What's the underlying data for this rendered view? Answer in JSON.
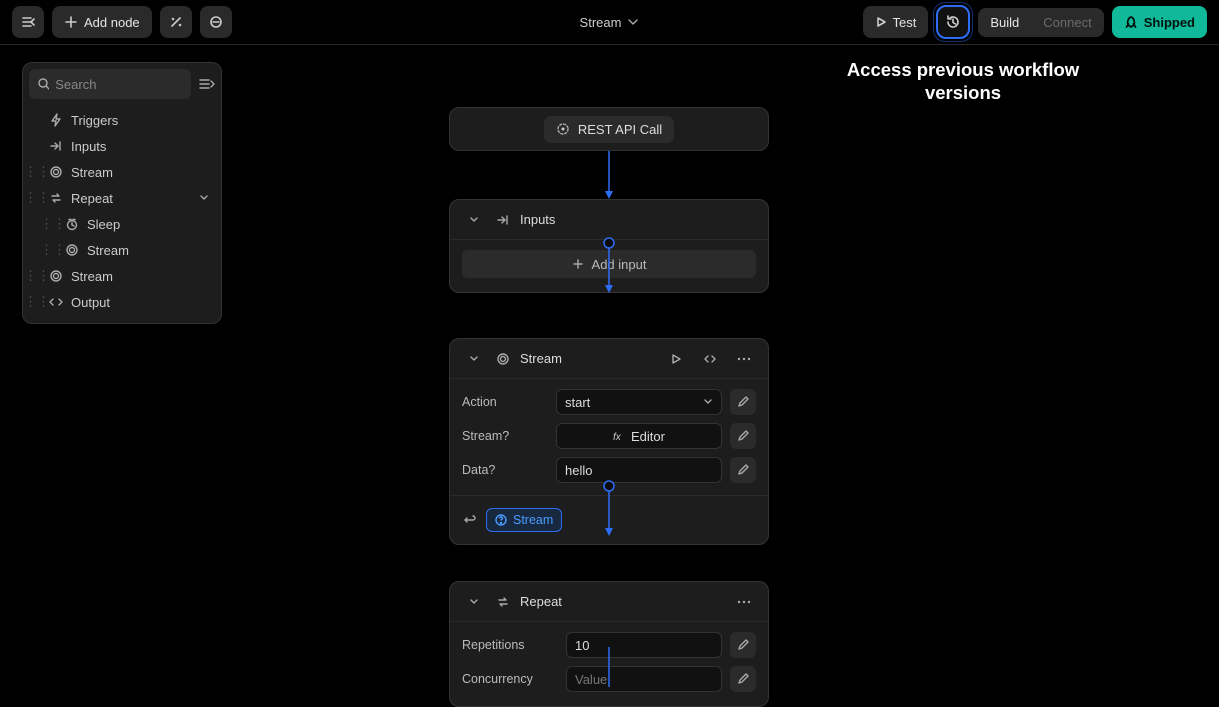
{
  "header": {
    "title": "Stream",
    "add_node_label": "Add node",
    "test_label": "Test",
    "tabs": {
      "build": "Build",
      "connect": "Connect"
    },
    "shipped_label": "Shipped"
  },
  "callout": "Access previous workflow versions",
  "sidebar": {
    "search_placeholder": "Search",
    "items": [
      {
        "label": "Triggers",
        "icon": "bolt-icon"
      },
      {
        "label": "Inputs",
        "icon": "inputs-icon"
      },
      {
        "label": "Stream",
        "icon": "stream-icon"
      },
      {
        "label": "Repeat",
        "icon": "repeat-icon"
      },
      {
        "label": "Sleep",
        "icon": "clock-icon"
      },
      {
        "label": "Stream",
        "icon": "stream-icon"
      },
      {
        "label": "Stream",
        "icon": "stream-icon"
      },
      {
        "label": "Output",
        "icon": "output-icon"
      }
    ]
  },
  "nodes": {
    "api": {
      "label": "REST API Call"
    },
    "inputs": {
      "title": "Inputs",
      "add_label": "Add input"
    },
    "stream": {
      "title": "Stream",
      "action_label": "Action",
      "action_value": "start",
      "streamq_label": "Stream?",
      "streamq_value": "Editor",
      "data_label": "Data?",
      "data_value": "hello",
      "chip_label": "Stream"
    },
    "repeat": {
      "title": "Repeat",
      "reps_label": "Repetitions",
      "reps_value": "10",
      "conc_label": "Concurrency",
      "conc_placeholder": "Value"
    }
  }
}
